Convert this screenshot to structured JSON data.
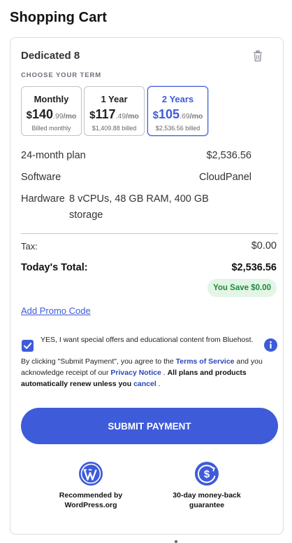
{
  "page": {
    "title": "Shopping Cart"
  },
  "cart": {
    "plan_name": "Dedicated 8",
    "term_label": "CHOOSE YOUR TERM",
    "terms": [
      {
        "title": "Monthly",
        "dollar": "$",
        "price_main": "140",
        "price_cents": ".99",
        "unit": "/mo",
        "billed": "Billed monthly",
        "selected": false
      },
      {
        "title": "1 Year",
        "dollar": "$",
        "price_main": "117",
        "price_cents": ".49",
        "unit": "/mo",
        "billed": "$1,409.88 billed",
        "selected": false
      },
      {
        "title": "2 Years",
        "dollar": "$",
        "price_main": "105",
        "price_cents": ".69",
        "unit": "/mo",
        "billed": "$2,536.56 billed",
        "selected": true
      }
    ],
    "details": {
      "plan_key": "24-month plan",
      "plan_value": "$2,536.56",
      "software_key": "Software",
      "software_value": "CloudPanel",
      "hardware_key": "Hardware",
      "hardware_value": "8 vCPUs, 48 GB RAM, 400 GB storage"
    },
    "tax_label": "Tax:",
    "tax_value": "$0.00",
    "total_label": "Today's Total:",
    "total_value": "$2,536.56",
    "savings": "You Save $0.00",
    "promo_link": "Add Promo Code",
    "offers_checkbox_checked": true,
    "offers_text": "YES, I want special offers and educational content from Bluehost.",
    "legal": {
      "part1": "By clicking \"Submit Payment\", you agree to the ",
      "tos_link": "Terms of Service",
      "part2": " and you acknowledge receipt of our ",
      "privacy_link": "Privacy Notice",
      "part3": " . ",
      "bold_text": "All plans and products automatically renew unless you ",
      "cancel_link": "cancel",
      "part4": " ."
    },
    "submit_label": "SUBMIT PAYMENT",
    "badges": [
      {
        "icon": "wordpress-icon",
        "text": "Recommended by WordPress.org"
      },
      {
        "icon": "money-back-icon",
        "text": "30-day money-back guarantee"
      }
    ]
  },
  "colors": {
    "accent": "#3e5bd9",
    "link": "#2b46b8",
    "savings_bg": "#e3f5e6",
    "savings_text": "#1e8a3c"
  }
}
